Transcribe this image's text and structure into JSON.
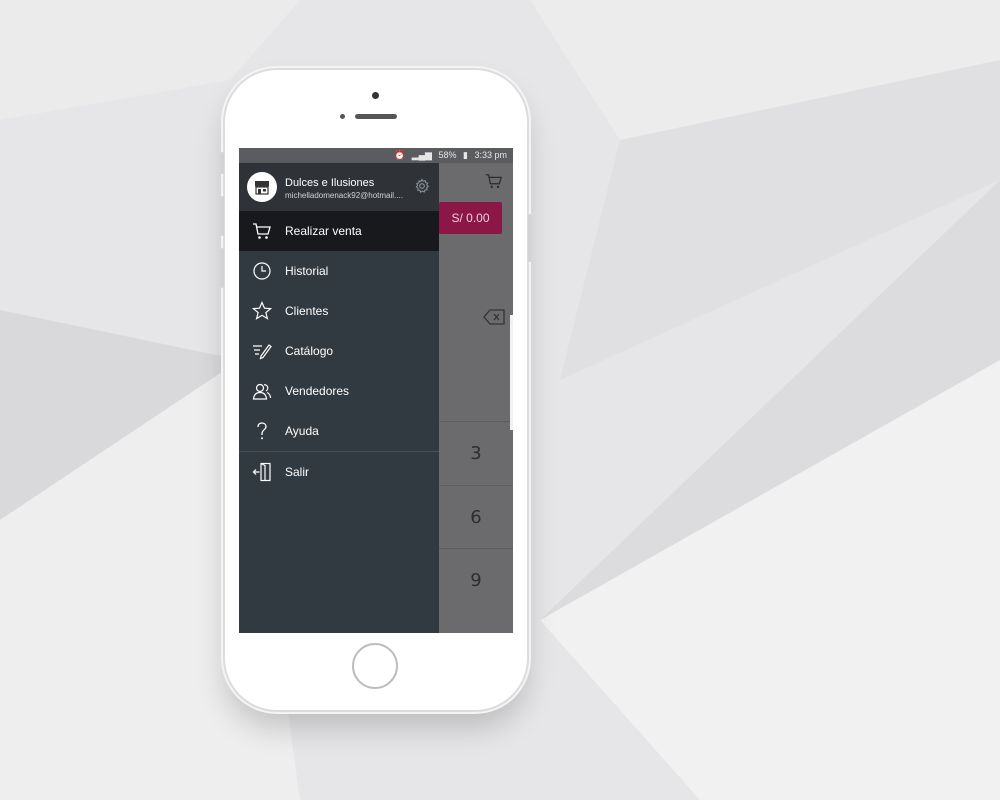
{
  "status_bar": {
    "battery": "58%",
    "time": "3:33 pm"
  },
  "app": {
    "amount_button": "S/ 0.00",
    "keypad_keys": [
      "3",
      "6",
      "9"
    ]
  },
  "drawer": {
    "store_name": "Dulces e Ilusiones",
    "store_email": "michelladomenack92@hotmail....",
    "items": [
      {
        "label": "Realizar venta",
        "icon": "cart-icon",
        "active": true
      },
      {
        "label": "Historial",
        "icon": "clock-icon",
        "active": false
      },
      {
        "label": "Clientes",
        "icon": "star-icon",
        "active": false
      },
      {
        "label": "Catálogo",
        "icon": "catalog-pen-icon",
        "active": false
      },
      {
        "label": "Vendedores",
        "icon": "users-icon",
        "active": false
      },
      {
        "label": "Ayuda",
        "icon": "question-icon",
        "active": false
      },
      {
        "label": "Salir",
        "icon": "exit-door-icon",
        "active": false
      }
    ]
  },
  "colors": {
    "drawer_bg": "#323a41",
    "active_item_bg": "#17191c",
    "accent": "#8a1746"
  }
}
